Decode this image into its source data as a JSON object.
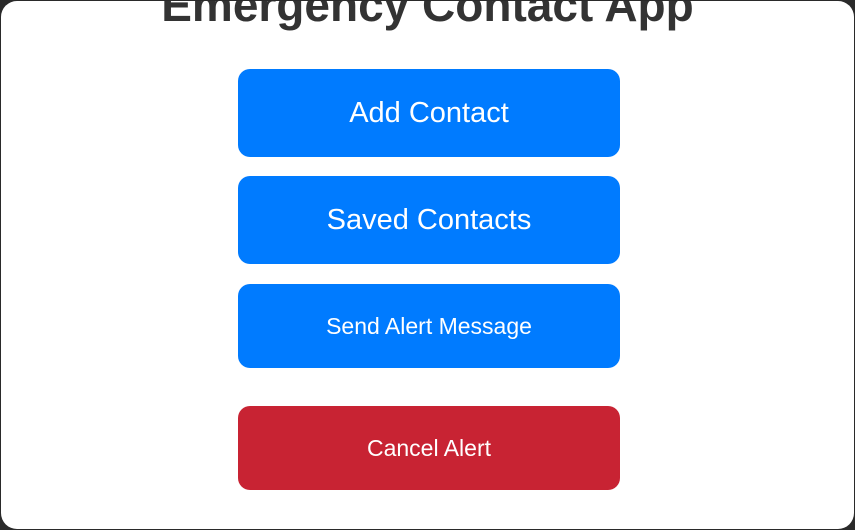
{
  "app": {
    "title": "Emergency Contact App"
  },
  "buttons": {
    "add_contact": "Add Contact",
    "saved_contacts": "Saved Contacts",
    "send_alert": "Send Alert Message",
    "cancel_alert": "Cancel Alert"
  },
  "colors": {
    "primary": "#007bff",
    "danger": "#c82333",
    "title_text": "#333333",
    "background": "#ffffff"
  }
}
